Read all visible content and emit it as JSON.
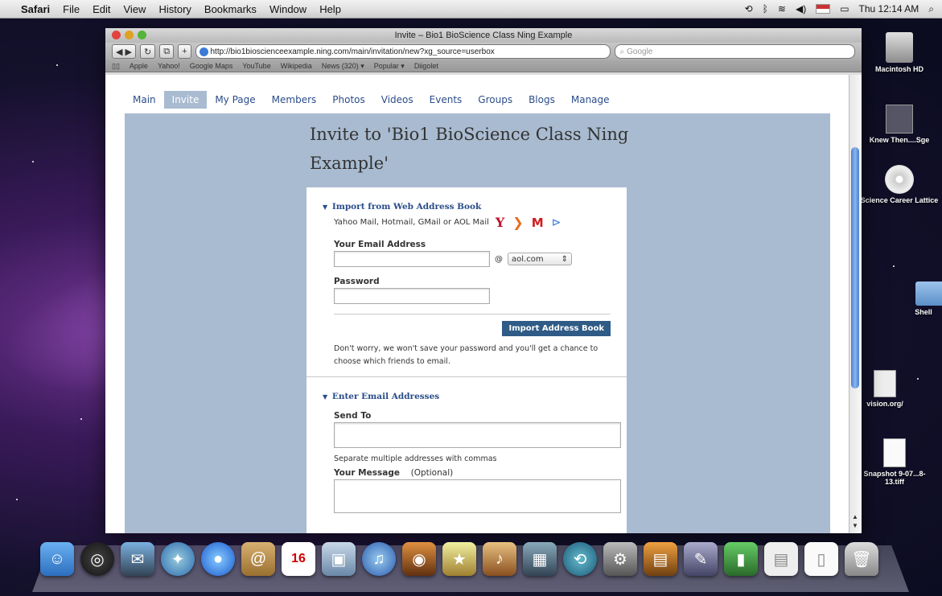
{
  "menubar": {
    "apple": "",
    "items": [
      "Safari",
      "File",
      "Edit",
      "View",
      "History",
      "Bookmarks",
      "Window",
      "Help"
    ],
    "clock": "Thu 12:14 AM"
  },
  "window": {
    "title": "Invite – Bio1 BioScience Class Ning Example",
    "url": "http://bio1bioscienceexample.ning.com/main/invitation/new?xg_source=userbox",
    "search_placeholder": "Google",
    "bookmarks": [
      "Apple",
      "Yahoo!",
      "Google Maps",
      "YouTube",
      "Wikipedia",
      "News (320) ▾",
      "Popular ▾",
      "Diigolet"
    ]
  },
  "nav": {
    "tabs": [
      "Main",
      "Invite",
      "My Page",
      "Members",
      "Photos",
      "Videos",
      "Events",
      "Groups",
      "Blogs",
      "Manage"
    ],
    "active": "Invite"
  },
  "page": {
    "title": "Invite to 'Bio1 BioScience Class Ning Example'"
  },
  "import": {
    "heading": "Import from Web Address Book",
    "providers_text": "Yahoo Mail, Hotmail, GMail or AOL Mail",
    "email_label": "Your Email Address",
    "at": "@",
    "domain_selected": "aol.com",
    "password_label": "Password",
    "button": "Import Address Book",
    "note": "Don't worry, we won't save your password and you'll get a chance to choose which friends to email."
  },
  "enter": {
    "heading": "Enter Email Addresses",
    "send_to_label": "Send To",
    "separate_note": "Separate multiple addresses with commas",
    "message_label": "Your Message",
    "optional": "(Optional)"
  },
  "desktop": {
    "icons": [
      "Macintosh HD",
      "Knew Then....Sge",
      "Science Career Lattice",
      "Shell",
      "vision.org/",
      "Snapshot 9-07...8-13.tiff"
    ]
  },
  "colors": {
    "nav_panel": "#a9bbd0",
    "link": "#2a4d8a",
    "button": "#2f5b86"
  }
}
